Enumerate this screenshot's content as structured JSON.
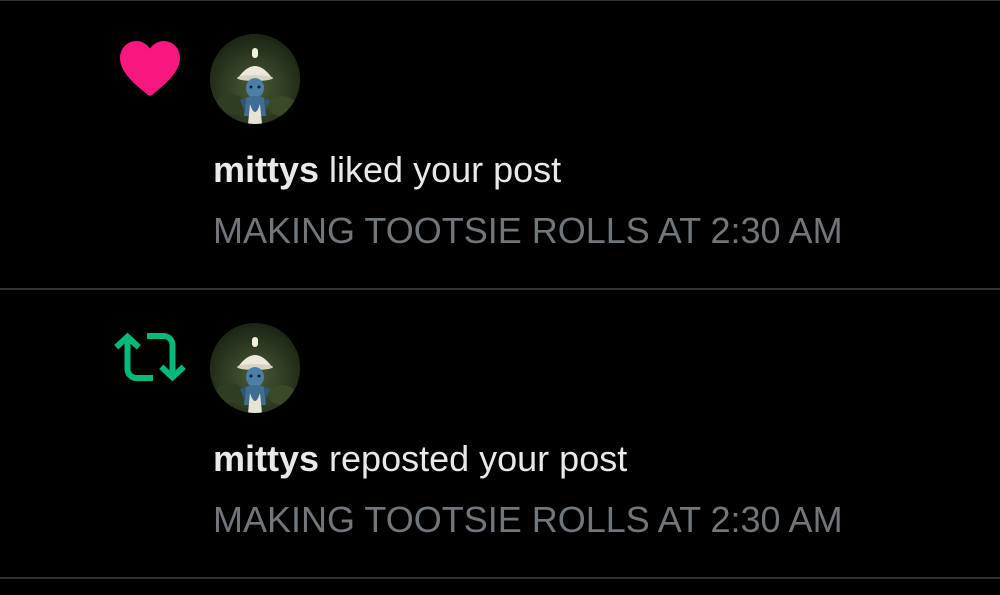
{
  "colors": {
    "background": "#000000",
    "divider": "#2f3336",
    "primary_text": "#e7e9ea",
    "secondary_text": "#71767b",
    "like": "#f91880",
    "repost": "#00ba7c"
  },
  "notifications": [
    {
      "type_icon": "heart-icon",
      "avatar": "user-avatar",
      "username": "mittys",
      "action": " liked your post",
      "post_preview": "MAKING TOOTSIE ROLLS AT 2:30 AM"
    },
    {
      "type_icon": "repost-icon",
      "avatar": "user-avatar",
      "username": "mittys",
      "action": " reposted your post",
      "post_preview": "MAKING TOOTSIE ROLLS AT 2:30 AM"
    }
  ]
}
